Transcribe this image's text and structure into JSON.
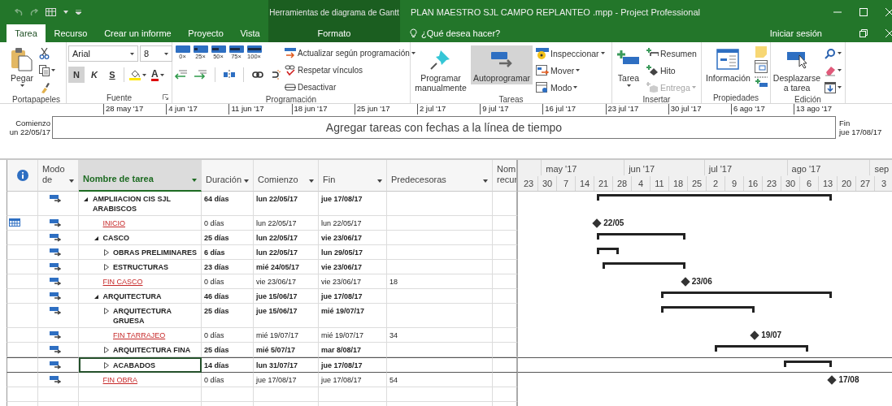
{
  "title_bar": {
    "context_title": "Herramientas de diagrama de Gantt",
    "title": "PLAN MAESTRO SJL CAMPO REPLANTEO .mpp - Project Professional"
  },
  "tabs": [
    {
      "label": "Tarea",
      "selected": true,
      "contextual": false
    },
    {
      "label": "Recurso",
      "selected": false,
      "contextual": false
    },
    {
      "label": "Crear un informe",
      "selected": false,
      "contextual": false
    },
    {
      "label": "Proyecto",
      "selected": false,
      "contextual": false
    },
    {
      "label": "Vista",
      "selected": false,
      "contextual": false
    },
    {
      "label": "Formato",
      "selected": false,
      "contextual": true
    }
  ],
  "tell_me": {
    "placeholder": "¿Qué desea hacer?"
  },
  "sign_in": "Iniciar sesión",
  "ribbon": {
    "portapapeles": {
      "label": "Portapapeles",
      "paste": "Pegar"
    },
    "fuente": {
      "label": "Fuente",
      "font": "Arial",
      "size": "8",
      "format_buttons": [
        {
          "label": "N",
          "on": true
        },
        {
          "label": "K",
          "on": false
        },
        {
          "label": "S",
          "on": false
        }
      ],
      "font_color": "A"
    },
    "programacion": {
      "label": "Programación",
      "percent_buttons": [
        "0×",
        "25×",
        "50×",
        "75×",
        "100×"
      ],
      "commands": [
        {
          "label": "Actualizar según programación",
          "dropdown": true
        },
        {
          "label": "Respetar vínculos",
          "dropdown": false
        },
        {
          "label": "Desactivar",
          "dropdown": false
        }
      ]
    },
    "tareas": {
      "label": "Tareas",
      "large_buttons": [
        {
          "label": "Programar manualmente",
          "selected": false
        },
        {
          "label": "Autoprogramar",
          "selected": true
        }
      ],
      "commands": [
        {
          "label": "Inspeccionar",
          "dropdown": true
        },
        {
          "label": "Mover",
          "dropdown": true
        },
        {
          "label": "Modo",
          "dropdown": true
        }
      ]
    },
    "insertar": {
      "label": "Insertar",
      "task": "Tarea",
      "commands": [
        {
          "label": "Resumen",
          "disabled": false,
          "dropdown": false
        },
        {
          "label": "Hito",
          "disabled": false,
          "dropdown": false
        },
        {
          "label": "Entrega",
          "disabled": true,
          "dropdown": true
        }
      ]
    },
    "propiedades": {
      "label": "Propiedades",
      "info": "Información"
    },
    "edicion": {
      "label": "Edición",
      "scroll_to": "Desplazarse a tarea"
    }
  },
  "timeline": {
    "ticks": [
      "28 may '17",
      "4 jun '17",
      "11 jun '17",
      "18 jun '17",
      "25 jun '17",
      "2 jul '17",
      "9 jul '17",
      "16 jul '17",
      "23 jul '17",
      "30 jul '17",
      "6 ago '17",
      "13 ago '17"
    ],
    "start_label": "Comienzo",
    "start_date": "un 22/05/17",
    "hint": "Agregar tareas con fechas a la línea de tiempo",
    "end_label": "Fin",
    "end_date": "jue 17/08/17"
  },
  "table": {
    "columns": [
      {
        "kind": "indicators"
      },
      {
        "kind": "narrow",
        "label": "Modo de",
        "dropdown": true,
        "selected": false
      },
      {
        "kind": "field",
        "label": "Nombre de tarea",
        "dropdown": true,
        "selected": true
      },
      {
        "kind": "field",
        "label": "Duración",
        "dropdown": true,
        "selected": false
      },
      {
        "kind": "field",
        "label": "Comienzo",
        "dropdown": true,
        "selected": false
      },
      {
        "kind": "field",
        "label": "Fin",
        "dropdown": true,
        "selected": false
      },
      {
        "kind": "field",
        "label": "Predecesoras",
        "dropdown": true,
        "selected": false
      },
      {
        "kind": "narrow",
        "label": "Nom recur",
        "dropdown": false,
        "selected": false
      }
    ],
    "rows": [
      {
        "kind": "summary",
        "name": "AMPLIIACION CIS SJL ARABISCOS",
        "expanded": true,
        "duration": "64 días",
        "start": "lun 22/05/17",
        "finish": "jue 17/08/17",
        "selected": false,
        "calendar_indicator": false,
        "children": [
          {
            "kind": "milestone",
            "name": "INICIO",
            "duration": "0 días",
            "start": "lun 22/05/17",
            "finish": "lun 22/05/17",
            "gantt_label": "22/05",
            "selected": false,
            "calendar_indicator": true
          },
          {
            "kind": "summary",
            "name": "CASCO",
            "expanded": true,
            "duration": "25 días",
            "start": "lun 22/05/17",
            "finish": "vie 23/06/17",
            "selected": false,
            "calendar_indicator": false,
            "children": [
              {
                "kind": "summary",
                "name": "OBRAS PRELIMINARES",
                "expanded": false,
                "duration": "6 días",
                "start": "lun 22/05/17",
                "finish": "lun 29/05/17",
                "selected": false,
                "calendar_indicator": false
              },
              {
                "kind": "summary",
                "name": "ESTRUCTURAS",
                "expanded": false,
                "duration": "23 días",
                "start": "mié 24/05/17",
                "finish": "vie 23/06/17",
                "selected": false,
                "calendar_indicator": false
              }
            ]
          },
          {
            "kind": "milestone",
            "name": "FIN CASCO",
            "duration": "0 días",
            "start": "vie 23/06/17",
            "finish": "vie 23/06/17",
            "predecessors": "18",
            "gantt_label": "23/06",
            "selected": false,
            "calendar_indicator": false
          },
          {
            "kind": "summary",
            "name": "ARQUITECTURA",
            "expanded": true,
            "duration": "46 días",
            "start": "jue 15/06/17",
            "finish": "jue 17/08/17",
            "selected": false,
            "calendar_indicator": false,
            "children": [
              {
                "kind": "summary",
                "name": "ARQUITECTURA GRUESA",
                "expanded": false,
                "duration": "25 días",
                "start": "jue 15/06/17",
                "finish": "mié 19/07/17",
                "selected": false,
                "calendar_indicator": false
              },
              {
                "kind": "milestone",
                "name": "FIN TARRAJEO",
                "duration": "0 días",
                "start": "mié 19/07/17",
                "finish": "mié 19/07/17",
                "predecessors": "34",
                "gantt_label": "19/07",
                "selected": false,
                "calendar_indicator": false
              },
              {
                "kind": "summary",
                "name": "ARQUITECTURA FINA",
                "expanded": false,
                "duration": "25 días",
                "start": "mié 5/07/17",
                "finish": "mar 8/08/17",
                "selected": false,
                "calendar_indicator": false
              },
              {
                "kind": "summary",
                "name": "ACABADOS",
                "expanded": false,
                "duration": "14 días",
                "start": "lun 31/07/17",
                "finish": "jue 17/08/17",
                "selected": true,
                "calendar_indicator": false
              }
            ]
          },
          {
            "kind": "milestone",
            "name": "FIN OBRA",
            "duration": "0 días",
            "start": "jue 17/08/17",
            "finish": "jue 17/08/17",
            "predecessors": "54",
            "gantt_label": "17/08",
            "selected": false,
            "calendar_indicator": false
          }
        ]
      }
    ]
  },
  "gantt": {
    "months": [
      "may '17",
      "jun '17",
      "jul '17",
      "ago '17",
      "sep"
    ],
    "weeks": [
      "23",
      "30",
      "7",
      "14",
      "21",
      "28",
      "4",
      "11",
      "18",
      "25",
      "2",
      "9",
      "16",
      "23",
      "30",
      "6",
      "13",
      "20",
      "27",
      "3"
    ]
  }
}
